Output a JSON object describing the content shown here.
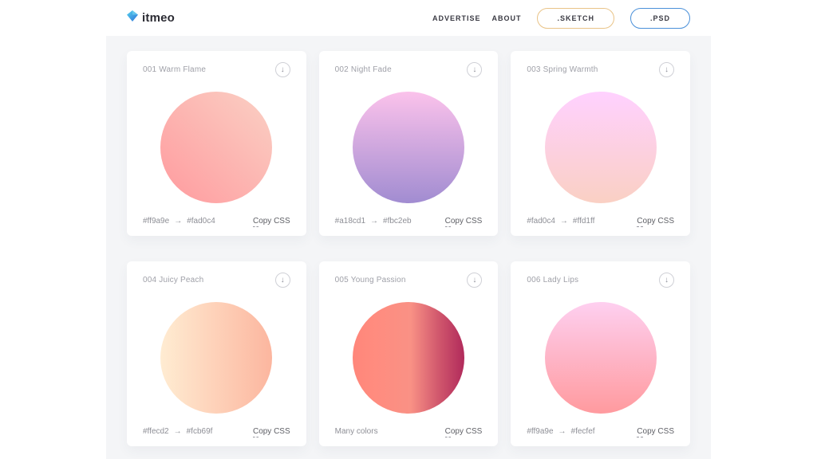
{
  "header": {
    "logo_text": "itmeo",
    "nav": [
      {
        "label": "ADVERTISE"
      },
      {
        "label": "ABOUT"
      }
    ],
    "actions": [
      {
        "label": ".SKETCH",
        "style": "border-color:#e9c387"
      },
      {
        "label": ".PSD",
        "style": "border-color:#4a90d9"
      }
    ]
  },
  "cards": [
    {
      "title": "001 Warm Flame",
      "circle_style": "background:linear-gradient(45deg,#ff9a9e 0%,#fad0c4 99%,#fad0c4 100%)",
      "hex_from": "#ff9a9e",
      "arrow": "→",
      "hex_to": "#fad0c4",
      "copy_key": "C",
      "copy_rest": "opy CSS"
    },
    {
      "title": "002 Night Fade",
      "circle_style": "background:linear-gradient(to top,#a18cd1 0%,#fbc2eb 100%)",
      "hex_from": "#a18cd1",
      "arrow": "→",
      "hex_to": "#fbc2eb",
      "copy_key": "C",
      "copy_rest": "opy CSS"
    },
    {
      "title": "003 Spring Warmth",
      "circle_style": "background:linear-gradient(to top,#fad0c4 0%,#fad0c4 1%,#ffd1ff 100%)",
      "hex_from": "#fad0c4",
      "arrow": "→",
      "hex_to": "#ffd1ff",
      "copy_key": "C",
      "copy_rest": "opy CSS"
    },
    {
      "title": "004 Juicy Peach",
      "circle_style": "background:linear-gradient(to right,#ffecd2 0%,#fcb69f 100%)",
      "hex_from": "#ffecd2",
      "arrow": "→",
      "hex_to": "#fcb69f",
      "copy_key": "C",
      "copy_rest": "opy CSS"
    },
    {
      "title": "005 Young Passion",
      "circle_style": "background:linear-gradient(to right,#ff8177 0%,#ff867a 0%,#ff8c7f 21%,#f99185 52%,#cf556c 78%,#b12a5b 100%)",
      "hex_from": "Many colors",
      "copy_key": "C",
      "copy_rest": "opy CSS"
    },
    {
      "title": "006 Lady Lips",
      "circle_style": "background:linear-gradient(to top,#ff9a9e 0%,#fecfef 99%,#fecfef 100%)",
      "hex_from": "#ff9a9e",
      "arrow": "→",
      "hex_to": "#fecfef",
      "copy_key": "C",
      "copy_rest": "opy CSS"
    }
  ]
}
